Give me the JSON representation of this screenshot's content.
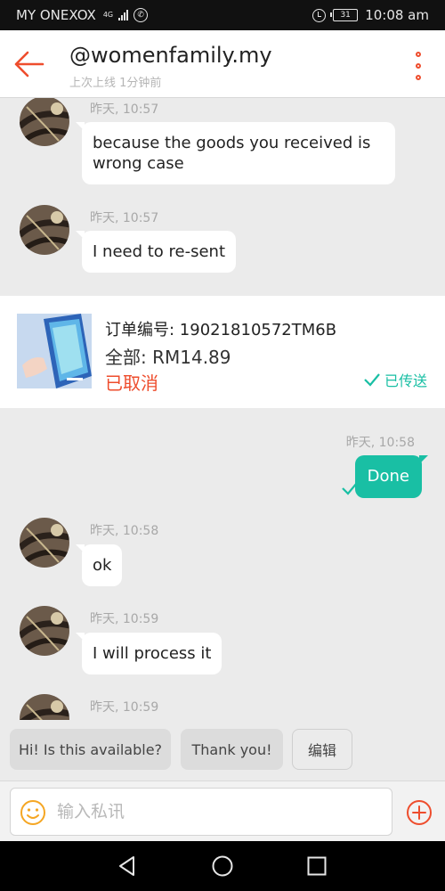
{
  "status_bar": {
    "carrier": "MY ONEXOX",
    "network": "4G",
    "battery": "31",
    "time": "10:08 am"
  },
  "header": {
    "title": "@womenfamily.my",
    "subtitle": "上次上线 1分钟前"
  },
  "messages": [
    {
      "side": "left",
      "time": "昨天, 10:57",
      "text": "because the goods you received is wrong case"
    },
    {
      "side": "left",
      "time": "昨天, 10:57",
      "text": "I need to re-sent"
    },
    {
      "side": "right",
      "time": "昨天, 10:58",
      "text": "Done"
    },
    {
      "side": "left",
      "time": "昨天, 10:58",
      "text": "ok"
    },
    {
      "side": "left",
      "time": "昨天, 10:59",
      "text": "I will process it"
    },
    {
      "side": "left",
      "time": "昨天, 10:59",
      "text": ""
    }
  ],
  "order": {
    "id_line": "订单编号: 19021810572TM6B",
    "total_line": "全部: RM14.89",
    "status": "已取消",
    "sent_label": "已传送"
  },
  "quick_replies": [
    "Hi! Is this available?",
    "Thank you!",
    "编辑"
  ],
  "composer": {
    "placeholder": "输入私讯"
  },
  "colors": {
    "accent": "#ee4d2d",
    "sent_bubble": "#19bfa4",
    "background": "#ebebeb"
  },
  "icons": [
    "back-arrow-icon",
    "more-vertical-icon",
    "emoji-icon",
    "add-icon",
    "check-icon",
    "nav-back-icon",
    "nav-home-icon",
    "nav-recents-icon"
  ]
}
